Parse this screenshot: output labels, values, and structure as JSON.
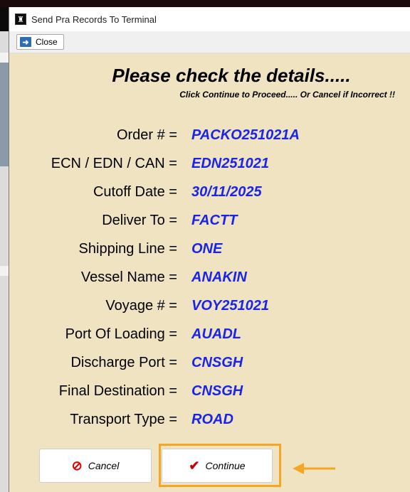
{
  "window": {
    "title": "Send Pra Records To Terminal"
  },
  "toolbar": {
    "close_label": "Close"
  },
  "dialog": {
    "heading": "Please check the details.....",
    "subheading": "Click Continue to Proceed..... Or Cancel if Incorrect !!",
    "fields": [
      {
        "label": "Order # =",
        "value": "PACKO251021A"
      },
      {
        "label": "ECN / EDN / CAN =",
        "value": "EDN251021"
      },
      {
        "label": "Cutoff Date =",
        "value": "30/11/2025"
      },
      {
        "label": "Deliver To =",
        "value": "FACTT"
      },
      {
        "label": "Shipping Line =",
        "value": "ONE"
      },
      {
        "label": "Vessel Name =",
        "value": "ANAKIN"
      },
      {
        "label": "Voyage # =",
        "value": "VOY251021"
      },
      {
        "label": "Port Of Loading =",
        "value": "AUADL"
      },
      {
        "label": "Discharge Port =",
        "value": "CNSGH"
      },
      {
        "label": "Final Destination =",
        "value": "CNSGH"
      },
      {
        "label": "Transport Type =",
        "value": "ROAD"
      }
    ],
    "cancel_label": "Cancel",
    "continue_label": "Continue"
  },
  "colors": {
    "content_bg": "#efe3c2",
    "value_text": "#1a24e8",
    "highlight": "#f5a623"
  },
  "icons": {
    "app": "app-icon",
    "close": "exit-arrow-icon",
    "cancel": "no-entry-icon",
    "continue": "checkmark-icon",
    "annotation": "arrow-left-icon"
  }
}
